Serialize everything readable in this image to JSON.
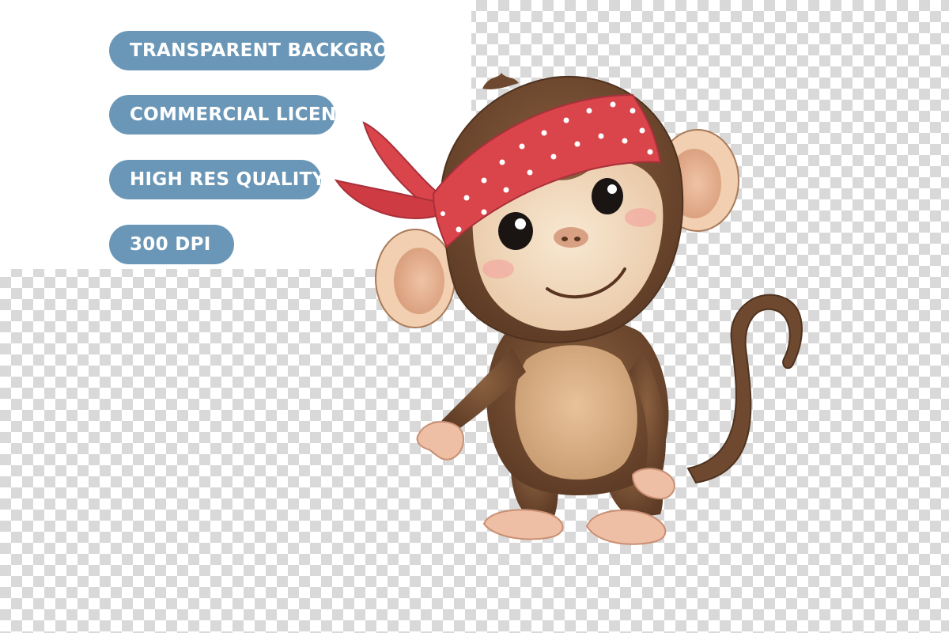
{
  "features": [
    {
      "label": "TRANSPARENT BACKGROUND"
    },
    {
      "label": "COMMERCIAL LICENSE"
    },
    {
      "label": "HIGH RES QUALITY"
    },
    {
      "label": "300 DPI"
    }
  ],
  "colors": {
    "pill_background": "#6a97b7",
    "bandana": "#d9454a",
    "fur": "#7a5236",
    "face": "#f3dcc0"
  },
  "illustration": {
    "subject": "monkey-with-red-polka-dot-bandana"
  }
}
